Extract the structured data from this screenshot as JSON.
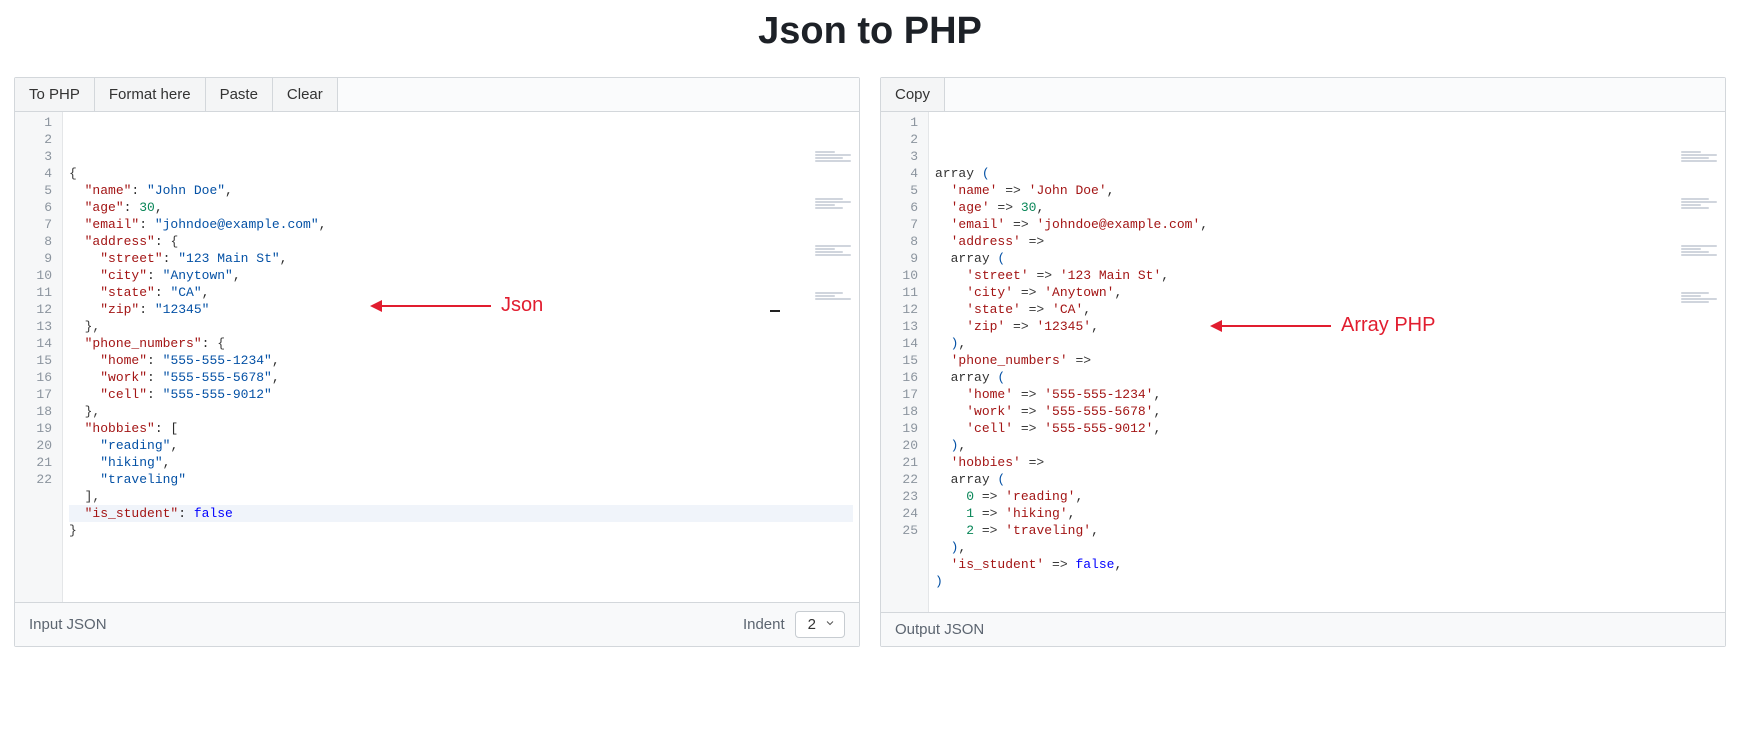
{
  "title": "Json to PHP",
  "leftToolbar": {
    "toPHP": "To PHP",
    "formatHere": "Format here",
    "paste": "Paste",
    "clear": "Clear"
  },
  "rightToolbar": {
    "copy": "Copy"
  },
  "leftFooter": {
    "label": "Input JSON",
    "indentLabel": "Indent",
    "indentValue": "2"
  },
  "rightFooter": {
    "label": "Output JSON"
  },
  "annotations": {
    "jsonLabel": "Json",
    "phpLabel": "Array PHP"
  },
  "jsonLines": [
    [
      [
        "plain",
        "{"
      ]
    ],
    [
      [
        "plain",
        "  "
      ],
      [
        "key",
        "\"name\""
      ],
      [
        "op",
        ": "
      ],
      [
        "str",
        "\"John Doe\""
      ],
      [
        "op",
        ","
      ]
    ],
    [
      [
        "plain",
        "  "
      ],
      [
        "key",
        "\"age\""
      ],
      [
        "op",
        ": "
      ],
      [
        "num",
        "30"
      ],
      [
        "op",
        ","
      ]
    ],
    [
      [
        "plain",
        "  "
      ],
      [
        "key",
        "\"email\""
      ],
      [
        "op",
        ": "
      ],
      [
        "str",
        "\"johndoe@example.com\""
      ],
      [
        "op",
        ","
      ]
    ],
    [
      [
        "plain",
        "  "
      ],
      [
        "key",
        "\"address\""
      ],
      [
        "op",
        ": "
      ],
      [
        "plain",
        "{"
      ]
    ],
    [
      [
        "plain",
        "    "
      ],
      [
        "key",
        "\"street\""
      ],
      [
        "op",
        ": "
      ],
      [
        "str",
        "\"123 Main St\""
      ],
      [
        "op",
        ","
      ]
    ],
    [
      [
        "plain",
        "    "
      ],
      [
        "key",
        "\"city\""
      ],
      [
        "op",
        ": "
      ],
      [
        "str",
        "\"Anytown\""
      ],
      [
        "op",
        ","
      ]
    ],
    [
      [
        "plain",
        "    "
      ],
      [
        "key",
        "\"state\""
      ],
      [
        "op",
        ": "
      ],
      [
        "str",
        "\"CA\""
      ],
      [
        "op",
        ","
      ]
    ],
    [
      [
        "plain",
        "    "
      ],
      [
        "key",
        "\"zip\""
      ],
      [
        "op",
        ": "
      ],
      [
        "str",
        "\"12345\""
      ]
    ],
    [
      [
        "plain",
        "  },"
      ]
    ],
    [
      [
        "plain",
        "  "
      ],
      [
        "key",
        "\"phone_numbers\""
      ],
      [
        "op",
        ": "
      ],
      [
        "plain",
        "{"
      ]
    ],
    [
      [
        "plain",
        "    "
      ],
      [
        "key",
        "\"home\""
      ],
      [
        "op",
        ": "
      ],
      [
        "str",
        "\"555-555-1234\""
      ],
      [
        "op",
        ","
      ]
    ],
    [
      [
        "plain",
        "    "
      ],
      [
        "key",
        "\"work\""
      ],
      [
        "op",
        ": "
      ],
      [
        "str",
        "\"555-555-5678\""
      ],
      [
        "op",
        ","
      ]
    ],
    [
      [
        "plain",
        "    "
      ],
      [
        "key",
        "\"cell\""
      ],
      [
        "op",
        ": "
      ],
      [
        "str",
        "\"555-555-9012\""
      ]
    ],
    [
      [
        "plain",
        "  },"
      ]
    ],
    [
      [
        "plain",
        "  "
      ],
      [
        "key",
        "\"hobbies\""
      ],
      [
        "op",
        ": ["
      ]
    ],
    [
      [
        "plain",
        "    "
      ],
      [
        "str",
        "\"reading\""
      ],
      [
        "op",
        ","
      ]
    ],
    [
      [
        "plain",
        "    "
      ],
      [
        "str",
        "\"hiking\""
      ],
      [
        "op",
        ","
      ]
    ],
    [
      [
        "plain",
        "    "
      ],
      [
        "str",
        "\"traveling\""
      ]
    ],
    [
      [
        "plain",
        "  ],"
      ]
    ],
    [
      [
        "plain",
        "  "
      ],
      [
        "key",
        "\"is_student\""
      ],
      [
        "op",
        ": "
      ],
      [
        "bool",
        "false"
      ]
    ],
    [
      [
        "plain",
        "}"
      ]
    ]
  ],
  "jsonCurrentLine": 21,
  "phpLines": [
    [
      [
        "fn",
        "array "
      ],
      [
        "paren",
        "("
      ]
    ],
    [
      [
        "plain",
        "  "
      ],
      [
        "pkey",
        "'name'"
      ],
      [
        "arrow",
        " => "
      ],
      [
        "pstr",
        "'John Doe'"
      ],
      [
        "op",
        ","
      ]
    ],
    [
      [
        "plain",
        "  "
      ],
      [
        "pkey",
        "'age'"
      ],
      [
        "arrow",
        " => "
      ],
      [
        "pnum",
        "30"
      ],
      [
        "op",
        ","
      ]
    ],
    [
      [
        "plain",
        "  "
      ],
      [
        "pkey",
        "'email'"
      ],
      [
        "arrow",
        " => "
      ],
      [
        "pstr",
        "'johndoe@example.com'"
      ],
      [
        "op",
        ","
      ]
    ],
    [
      [
        "plain",
        "  "
      ],
      [
        "pkey",
        "'address'"
      ],
      [
        "arrow",
        " =>"
      ]
    ],
    [
      [
        "plain",
        "  "
      ],
      [
        "fn",
        "array "
      ],
      [
        "paren",
        "("
      ]
    ],
    [
      [
        "plain",
        "    "
      ],
      [
        "pkey",
        "'street'"
      ],
      [
        "arrow",
        " => "
      ],
      [
        "pstr",
        "'123 Main St'"
      ],
      [
        "op",
        ","
      ]
    ],
    [
      [
        "plain",
        "    "
      ],
      [
        "pkey",
        "'city'"
      ],
      [
        "arrow",
        " => "
      ],
      [
        "pstr",
        "'Anytown'"
      ],
      [
        "op",
        ","
      ]
    ],
    [
      [
        "plain",
        "    "
      ],
      [
        "pkey",
        "'state'"
      ],
      [
        "arrow",
        " => "
      ],
      [
        "pstr",
        "'CA'"
      ],
      [
        "op",
        ","
      ]
    ],
    [
      [
        "plain",
        "    "
      ],
      [
        "pkey",
        "'zip'"
      ],
      [
        "arrow",
        " => "
      ],
      [
        "pstr",
        "'12345'"
      ],
      [
        "op",
        ","
      ]
    ],
    [
      [
        "plain",
        "  "
      ],
      [
        "paren",
        ")"
      ],
      [
        "op",
        ","
      ]
    ],
    [
      [
        "plain",
        "  "
      ],
      [
        "pkey",
        "'phone_numbers'"
      ],
      [
        "arrow",
        " =>"
      ]
    ],
    [
      [
        "plain",
        "  "
      ],
      [
        "fn",
        "array "
      ],
      [
        "paren",
        "("
      ]
    ],
    [
      [
        "plain",
        "    "
      ],
      [
        "pkey",
        "'home'"
      ],
      [
        "arrow",
        " => "
      ],
      [
        "pstr",
        "'555-555-1234'"
      ],
      [
        "op",
        ","
      ]
    ],
    [
      [
        "plain",
        "    "
      ],
      [
        "pkey",
        "'work'"
      ],
      [
        "arrow",
        " => "
      ],
      [
        "pstr",
        "'555-555-5678'"
      ],
      [
        "op",
        ","
      ]
    ],
    [
      [
        "plain",
        "    "
      ],
      [
        "pkey",
        "'cell'"
      ],
      [
        "arrow",
        " => "
      ],
      [
        "pstr",
        "'555-555-9012'"
      ],
      [
        "op",
        ","
      ]
    ],
    [
      [
        "plain",
        "  "
      ],
      [
        "paren",
        ")"
      ],
      [
        "op",
        ","
      ]
    ],
    [
      [
        "plain",
        "  "
      ],
      [
        "pkey",
        "'hobbies'"
      ],
      [
        "arrow",
        " =>"
      ]
    ],
    [
      [
        "plain",
        "  "
      ],
      [
        "fn",
        "array "
      ],
      [
        "paren",
        "("
      ]
    ],
    [
      [
        "plain",
        "    "
      ],
      [
        "pnum",
        "0"
      ],
      [
        "arrow",
        " => "
      ],
      [
        "pstr",
        "'reading'"
      ],
      [
        "op",
        ","
      ]
    ],
    [
      [
        "plain",
        "    "
      ],
      [
        "pnum",
        "1"
      ],
      [
        "arrow",
        " => "
      ],
      [
        "pstr",
        "'hiking'"
      ],
      [
        "op",
        ","
      ]
    ],
    [
      [
        "plain",
        "    "
      ],
      [
        "pnum",
        "2"
      ],
      [
        "arrow",
        " => "
      ],
      [
        "pstr",
        "'traveling'"
      ],
      [
        "op",
        ","
      ]
    ],
    [
      [
        "plain",
        "  "
      ],
      [
        "paren",
        ")"
      ],
      [
        "op",
        ","
      ]
    ],
    [
      [
        "plain",
        "  "
      ],
      [
        "pkey",
        "'is_student'"
      ],
      [
        "arrow",
        " => "
      ],
      [
        "bool",
        "false"
      ],
      [
        "op",
        ","
      ]
    ],
    [
      [
        "paren",
        ")"
      ]
    ]
  ]
}
